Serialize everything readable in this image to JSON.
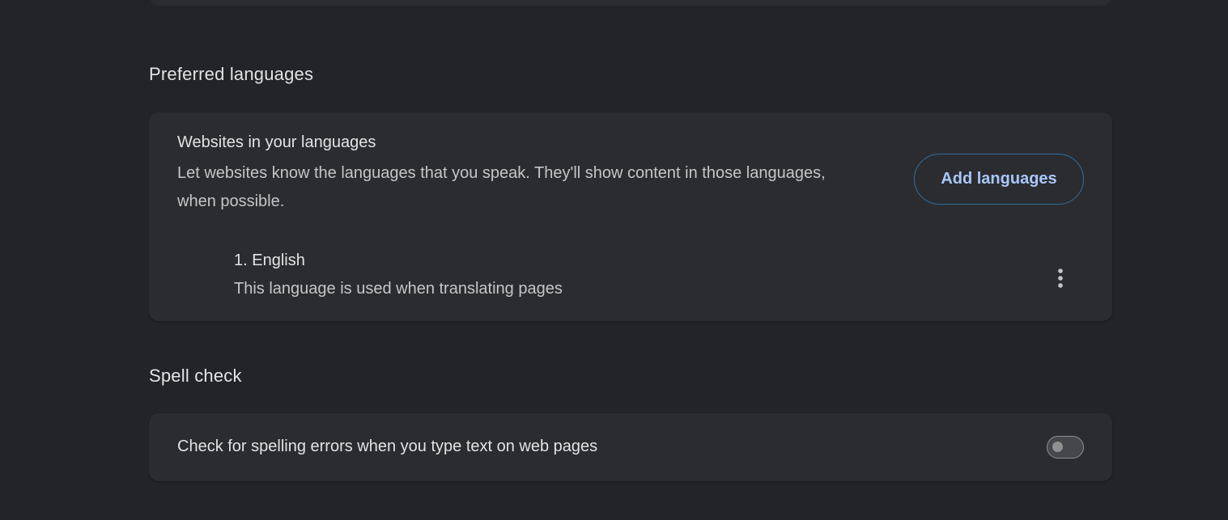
{
  "preferred_languages": {
    "section_title": "Preferred languages",
    "websites": {
      "title": "Websites in your languages",
      "description": "Let websites know the languages that you speak. They'll show content in those languages, when possible.",
      "add_button_label": "Add languages"
    },
    "languages": [
      {
        "name": "1. English",
        "subtitle": "This language is used when translating pages",
        "menu_icon": "more-vertical-icon"
      }
    ]
  },
  "spell_check": {
    "section_title": "Spell check",
    "toggle_label": "Check for spelling errors when you type text on web pages",
    "enabled": false
  },
  "colors": {
    "background": "#232428",
    "card": "#2b2c30",
    "accent": "#a8c7fa",
    "button_border": "#2f6fa0"
  }
}
